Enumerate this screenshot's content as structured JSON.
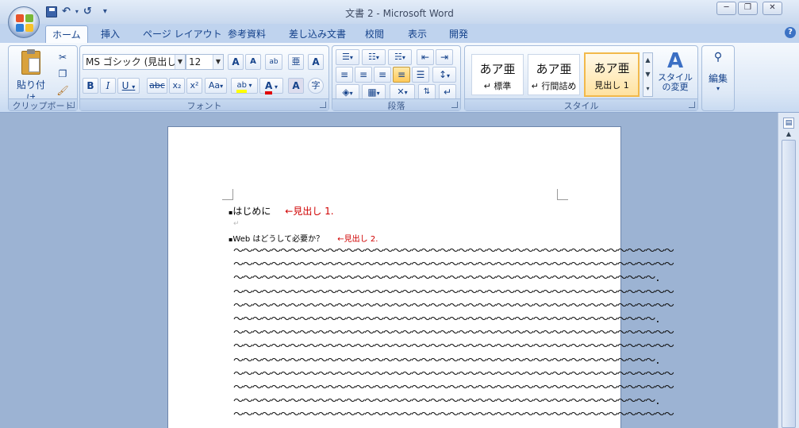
{
  "window": {
    "title": "文書 2 - Microsoft Word",
    "min": "─",
    "restore": "❐",
    "close": "✕"
  },
  "qat": {
    "save": "💾",
    "undo": "↶",
    "redo": "↺",
    "customize": "▾"
  },
  "tabs": [
    "ホーム",
    "挿入",
    "ページ レイアウト",
    "参考資料",
    "差し込み文書",
    "校閲",
    "表示",
    "開発"
  ],
  "help": "?",
  "clipboard": {
    "paste": "貼り付け",
    "group": "クリップボード"
  },
  "font": {
    "name": "MS ゴシック (見出しの:",
    "size": "12",
    "group": "フォント",
    "bold": "B",
    "italic": "I",
    "underline": "U",
    "strike": "abc",
    "sub": "x₂",
    "sup": "x²",
    "case": "Aa",
    "grow": "A",
    "shrink": "A",
    "highlight": "ab",
    "color": "A",
    "clear": "A",
    "phonetic": "亜",
    "enclosed": "字"
  },
  "paragraph": {
    "group": "段落"
  },
  "styles": {
    "group": "スタイル",
    "items": [
      {
        "sample": "あア亜",
        "name": "↵ 標準"
      },
      {
        "sample": "あア亜",
        "name": "↵ 行間詰め"
      },
      {
        "sample": "あア亜",
        "name": "見出し 1"
      }
    ],
    "change": "スタイルの変更"
  },
  "editing": {
    "label": "編集"
  },
  "document": {
    "heading1": "はじめに",
    "annot1": "←見出し 1.",
    "heading2": "Web はどうして必要か？",
    "annot2": "←見出し 2.",
    "lines": [
      "～～～～～～～～～～～～～～～～～～～～～～～～～～～～～～～～～～～～～～～～～～～～～～～",
      "～～～～～～～～～～～～～～～～～～～～～～～～～～～～～～～～～～～～～～～～～～～～～～～",
      "～～～～～～～～～～～～～～～～～～～～～～～～～～～～～～～～～～～～～～～～～～～～～.",
      "～～～～～～～～～～～～～～～～～～～～～～～～～～～～～～～～～～～～～～～～～～～～～～～",
      "～～～～～～～～～～～～～～～～～～～～～～～～～～～～～～～～～～～～～～～～～～～～～～～",
      "～～～～～～～～～～～～～～～～～～～～～～～～～～～～～～～～～～～～～～～～～～～～～.",
      "～～～～～～～～～～～～～～～～～～～～～～～～～～～～～～～～～～～～～～～～～～～～～～～",
      "～～～～～～～～～～～～～～～～～～～～～～～～～～～～～～～～～～～～～～～～～～～～～～～",
      "～～～～～～～～～～～～～～～～～～～～～～～～～～～～～～～～～～～～～～～～～～～～～.",
      "～～～～～～～～～～～～～～～～～～～～～～～～～～～～～～～～～～～～～～～～～～～～～～～",
      "～～～～～～～～～～～～～～～～～～～～～～～～～～～～～～～～～～～～～～～～～～～～～～～",
      "～～～～～～～～～～～～～～～～～～～～～～～～～～～～～～～～～～～～～～～～～～～～～.",
      "～～～～～～～～～～～～～～～～～～～～～～～～～～～～～～～～～～～～～～～～～～～～～～～"
    ]
  }
}
